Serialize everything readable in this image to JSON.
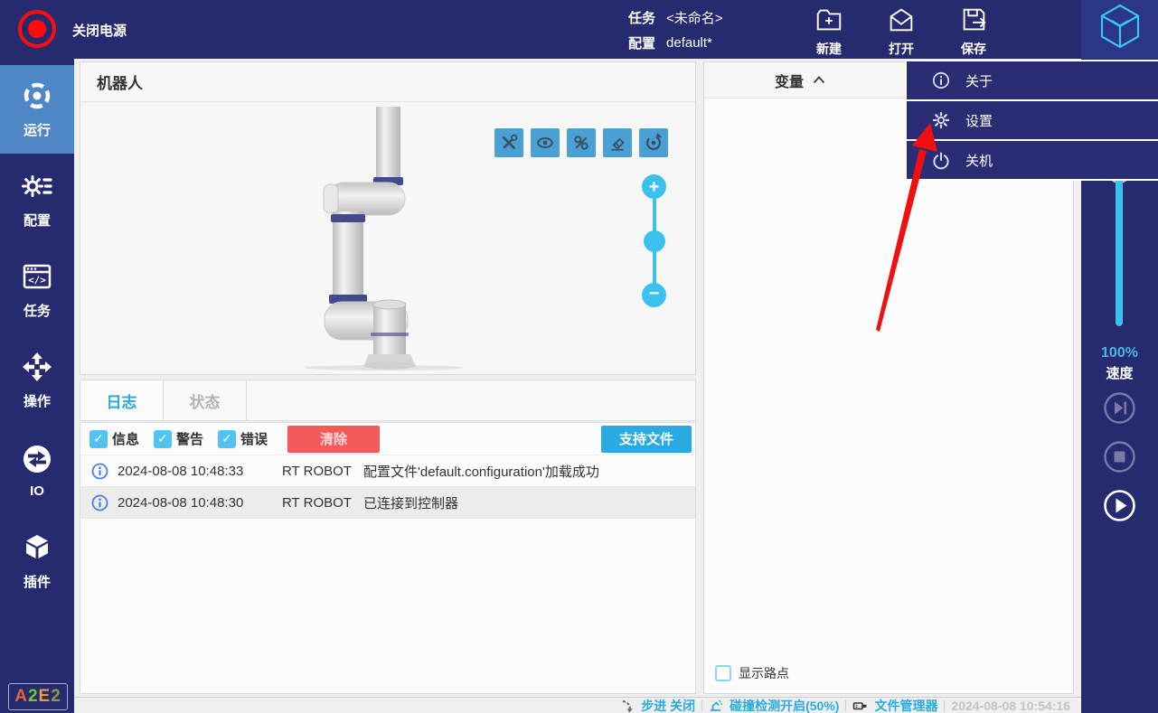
{
  "top_bar": {
    "power_label": "关闭电源",
    "task_label": "任务",
    "task_value": "<未命名>",
    "config_label": "配置",
    "config_value": "default*",
    "actions": [
      {
        "label": "新建",
        "icon": "new-task-icon"
      },
      {
        "label": "打开",
        "icon": "open-icon"
      },
      {
        "label": "保存",
        "icon": "save-icon"
      }
    ]
  },
  "menu": {
    "items": [
      {
        "label": "关于",
        "icon": "info-icon"
      },
      {
        "label": "设置",
        "icon": "gear-icon"
      },
      {
        "label": "关机",
        "icon": "shutdown-icon"
      }
    ]
  },
  "sidebar": {
    "items": [
      {
        "label": "运行",
        "icon": "run-icon",
        "active": true
      },
      {
        "label": "配置",
        "icon": "settings-icon",
        "active": false
      },
      {
        "label": "任务",
        "icon": "task-icon",
        "active": false
      },
      {
        "label": "操作",
        "icon": "move-icon",
        "active": false
      },
      {
        "label": "IO",
        "icon": "io-icon",
        "active": false
      },
      {
        "label": "插件",
        "icon": "plugin-icon",
        "active": false
      }
    ],
    "logo_letters": [
      "A",
      "2",
      "E",
      "2"
    ]
  },
  "robot_panel": {
    "title": "机器人",
    "toolbar_icons": [
      "tools-icon",
      "eye-icon",
      "waypoint-path-icon",
      "eraser-icon",
      "rotate-view-icon"
    ],
    "zoom_icons": [
      "zoom-in-icon",
      "zoom-slider-handle",
      "zoom-out-icon"
    ]
  },
  "log_panel": {
    "tabs": [
      {
        "label": "日志",
        "active": true
      },
      {
        "label": "状态",
        "active": false
      }
    ],
    "filters": [
      {
        "label": "信息",
        "checked": true
      },
      {
        "label": "警告",
        "checked": true
      },
      {
        "label": "错误",
        "checked": true
      }
    ],
    "clear_button": "清除",
    "support_button": "支持文件",
    "entries": [
      {
        "time": "2024-08-08 10:48:33",
        "source": "RT ROBOT",
        "message": "配置文件'default.configuration'加载成功"
      },
      {
        "time": "2024-08-08 10:48:30",
        "source": "RT ROBOT",
        "message": "已连接到控制器"
      }
    ]
  },
  "variables_panel": {
    "title": "变量",
    "collapse_icon": "chevron-up-icon",
    "show_waypoints_label": "显示路点",
    "show_waypoints_checked": false
  },
  "speed_control": {
    "percent": "100%",
    "label": "速度"
  },
  "playback": {
    "icons": [
      "step-forward-icon",
      "stop-icon",
      "play-icon"
    ]
  },
  "status_bar": {
    "step_label": "步进 关闭",
    "collision_label": "碰撞检测开启(50%)",
    "file_manager_label": "文件管理器",
    "timestamp": "2024-08-08 10:54:16"
  },
  "colors": {
    "navy": "#262a6e",
    "menu_navy": "#2a2c74",
    "sidebar_active": "#4e86c6",
    "accent_blue": "#29abe2",
    "cyan": "#3cc0ee",
    "toolbar_button_blue": "#4a9fd4",
    "clear_red": "#f55a5a",
    "power_red": "#ff0d0d",
    "logo_cyan": "#38c6f4",
    "info_icon_blue": "#4a7fe8",
    "timestamp_gray": "#c2c2c2",
    "arrow_red": "#f01010"
  }
}
